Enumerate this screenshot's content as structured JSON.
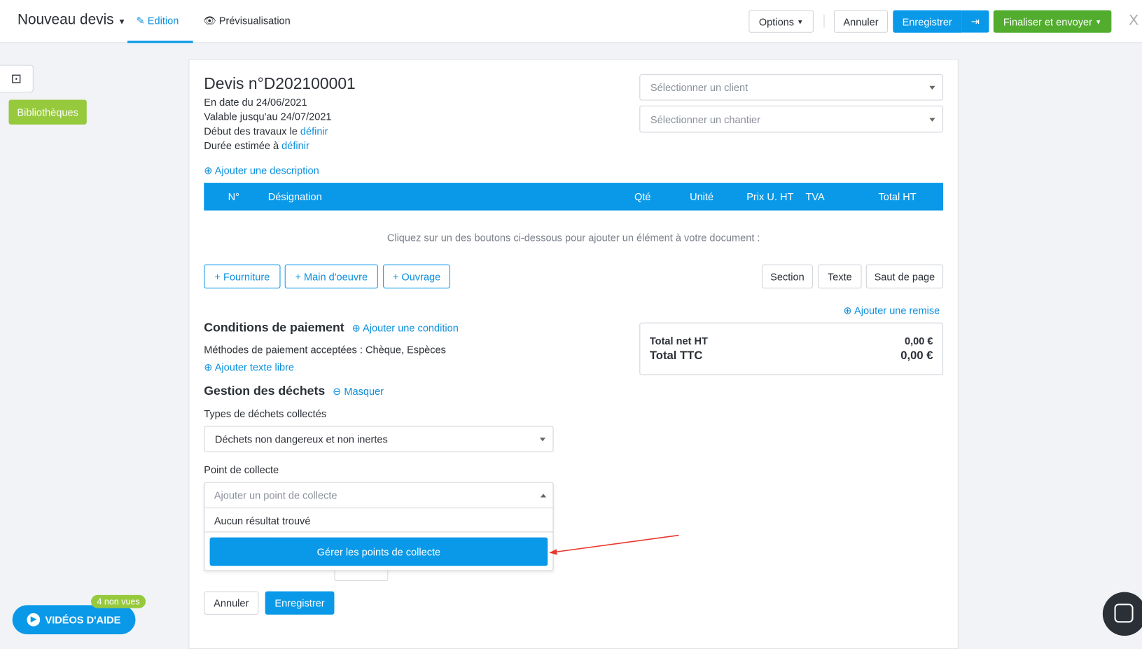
{
  "header": {
    "title": "Nouveau devis",
    "tabs": [
      {
        "label": "Edition",
        "active": true
      },
      {
        "label": "Prévisualisation",
        "active": false
      }
    ],
    "options": "Options",
    "cancel": "Annuler",
    "save": "Enregistrer",
    "finalize": "Finaliser et envoyer",
    "close": "X"
  },
  "sidebar": {
    "library_tooltip": "Bibliothèques"
  },
  "quote": {
    "title": "Devis n°D202100001",
    "date": "En date du 24/06/2021",
    "valid": "Valable jusqu'au 24/07/2021",
    "start_label": "Début des travaux le",
    "start_link": "définir",
    "duration_label": "Durée estimée à",
    "duration_link": "définir",
    "add_description": "Ajouter une description",
    "client_placeholder": "Sélectionner un client",
    "site_placeholder": "Sélectionner un chantier"
  },
  "table": {
    "columns": [
      "N°",
      "Désignation",
      "Qté",
      "Unité",
      "Prix U. HT",
      "TVA",
      "Total HT"
    ],
    "empty_hint": "Cliquez sur un des boutons ci-dessous pour ajouter un élément à votre document :"
  },
  "add_buttons": {
    "supply": "Fourniture",
    "labor": "Main d'oeuvre",
    "work": "Ouvrage",
    "section": "Section",
    "text": "Texte",
    "page_break": "Saut de page"
  },
  "payment": {
    "title": "Conditions de paiement",
    "add_condition": "Ajouter une condition",
    "methods": "Méthodes de paiement acceptées : Chèque, Espèces",
    "add_free_text": "Ajouter texte libre"
  },
  "totals": {
    "add_discount": "Ajouter une remise",
    "net_ht_label": "Total net HT",
    "net_ht": "0,00 €",
    "ttc_label": "Total TTC",
    "ttc": "0,00 €"
  },
  "waste": {
    "title": "Gestion des déchets",
    "hide": "Masquer",
    "types_label": "Types de déchets collectés",
    "types_value": "Déchets non dangereux et non inertes",
    "point_label": "Point de collecte",
    "point_placeholder": "Ajouter un point de collecte",
    "no_result": "Aucun résultat trouvé",
    "manage": "Gérer les points de collecte",
    "cancel": "Annuler",
    "save": "Enregistrer"
  },
  "help": {
    "videos": "VIDÉOS D'AIDE",
    "badge": "4 non vues"
  },
  "colors": {
    "primary": "#0a99e8",
    "success": "#52ad2f",
    "library": "#97c93d",
    "annotation": "#e8372c"
  }
}
